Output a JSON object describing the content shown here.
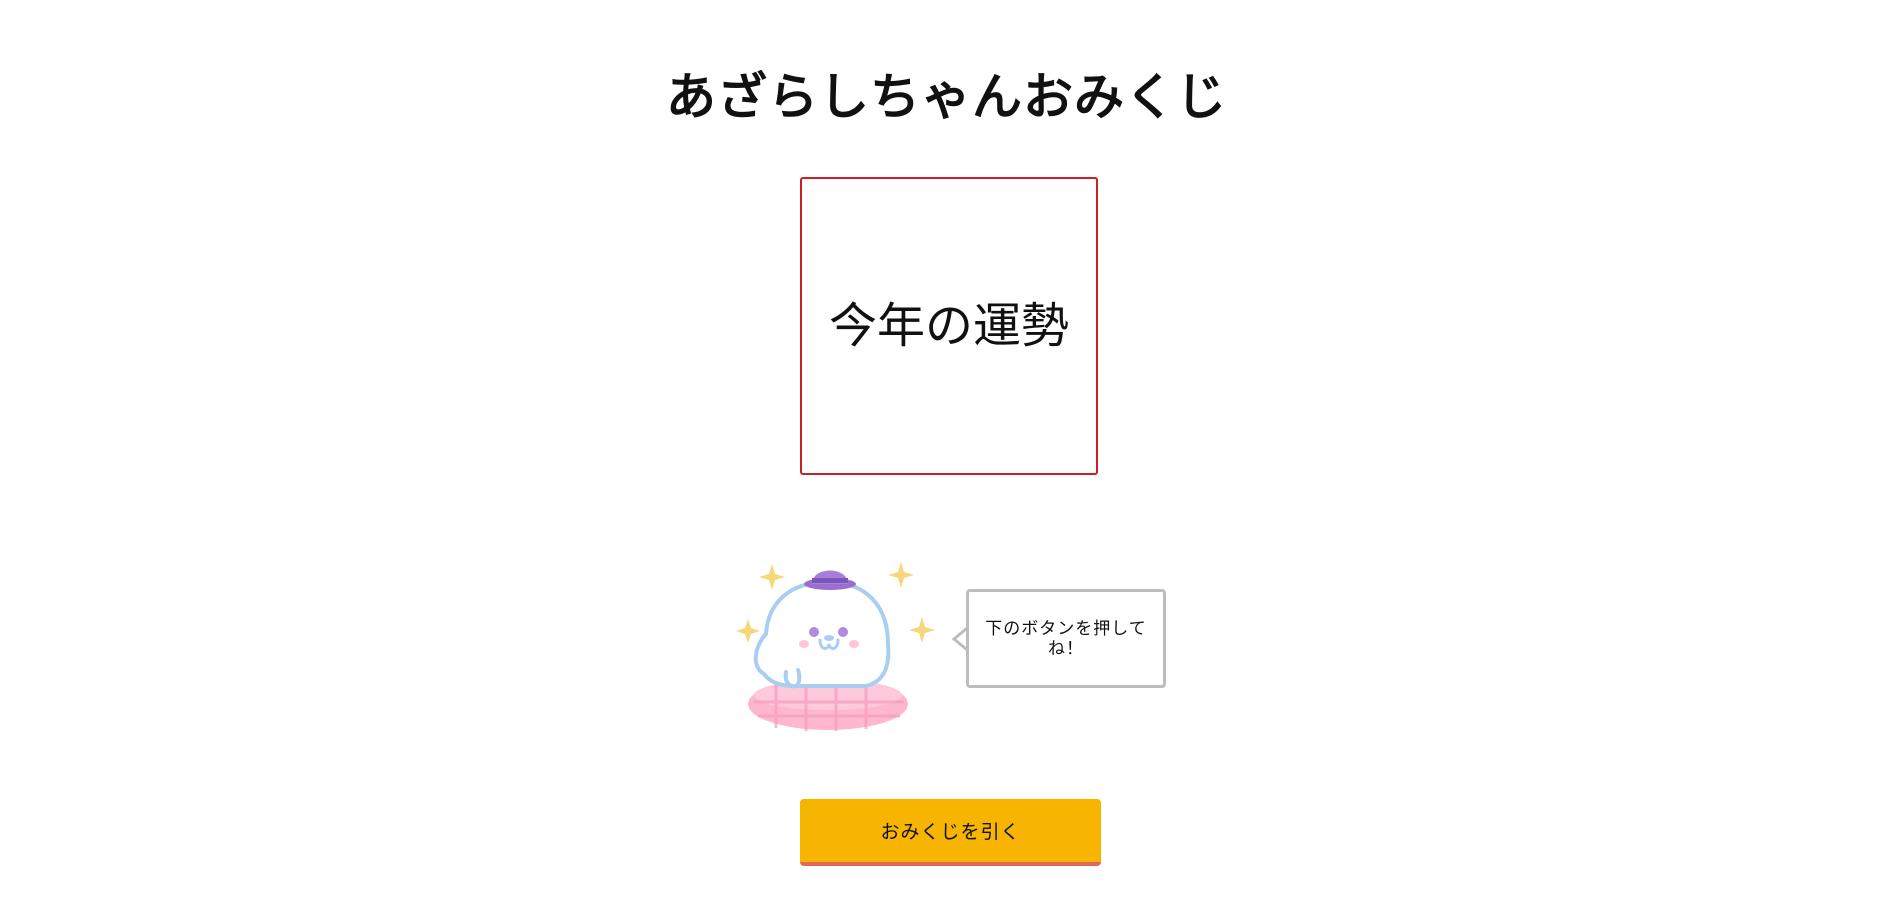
{
  "header": {
    "title": "あざらしちゃんおみくじ"
  },
  "fortune": {
    "text": "今年の運勢"
  },
  "mascot": {
    "icon": "seal-mascot-icon",
    "speech": "下のボタンを押してね！"
  },
  "actions": {
    "draw_label": "おみくじを引く"
  },
  "colors": {
    "fortune_border": "#cc1f1f",
    "button_bg": "#f7b400",
    "button_border": "#e06a5a",
    "bubble_border": "#bdbdbd"
  }
}
